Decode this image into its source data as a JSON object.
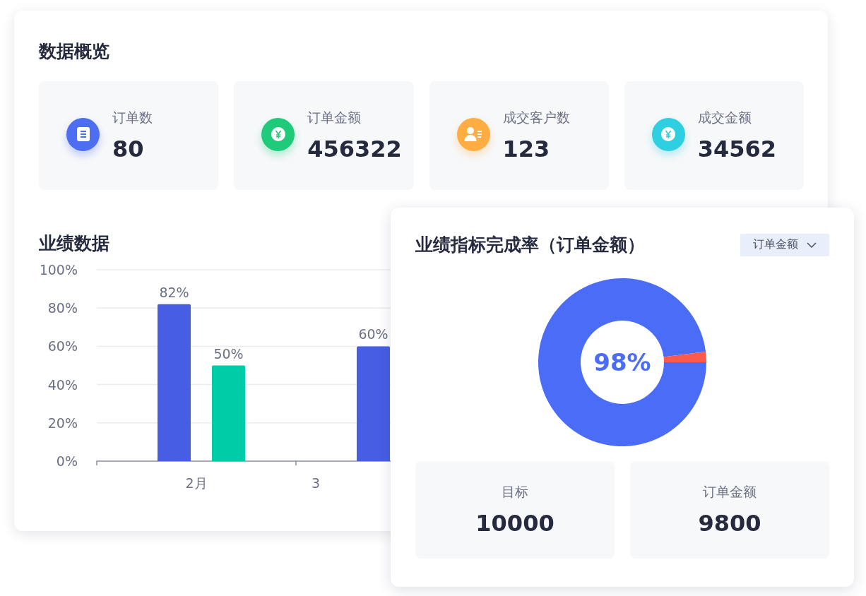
{
  "overview": {
    "title": "数据概览",
    "stats": [
      {
        "kind": "document",
        "label": "订单数",
        "value": "80",
        "color": "#4e6ef2"
      },
      {
        "kind": "coin",
        "label": "订单金额",
        "value": "456322",
        "color": "#1fcb7a"
      },
      {
        "kind": "customer",
        "label": "成交客户数",
        "value": "123",
        "color": "#ffad42"
      },
      {
        "kind": "coin",
        "label": "成交金额",
        "value": "34562",
        "color": "#2dcfe0"
      }
    ]
  },
  "performance": {
    "title": "业绩数据",
    "chart_data": {
      "type": "bar",
      "categories": [
        "2月",
        "3"
      ],
      "series": [
        {
          "color": "#465ee3",
          "values": [
            82,
            60
          ]
        },
        {
          "color": "#00cca8",
          "values": [
            50,
            null
          ]
        }
      ],
      "value_labels": [
        [
          "82%",
          "60%"
        ],
        [
          "50%",
          null
        ]
      ],
      "grid": true,
      "ylim": [
        0,
        100
      ],
      "yticks": [
        {
          "value": 0,
          "label": "0%"
        },
        {
          "value": 20,
          "label": "20%"
        },
        {
          "value": 40,
          "label": "40%"
        },
        {
          "value": 60,
          "label": "60%"
        },
        {
          "value": 80,
          "label": "80%"
        },
        {
          "value": 100,
          "label": "100%"
        }
      ]
    }
  },
  "completion": {
    "title": "业绩指标完成率（订单金额）",
    "dropdown": "订单金额",
    "chart_data": {
      "type": "donut",
      "series": [
        {
          "values": [
            98,
            2
          ]
        }
      ],
      "colors": [
        "#4a6cf7",
        "#fb5a4d"
      ],
      "value_labels": [
        [
          "98%",
          null
        ]
      ]
    },
    "stats": [
      {
        "label": "目标",
        "value": "10000"
      },
      {
        "label": "订单金额",
        "value": "9800"
      }
    ]
  }
}
